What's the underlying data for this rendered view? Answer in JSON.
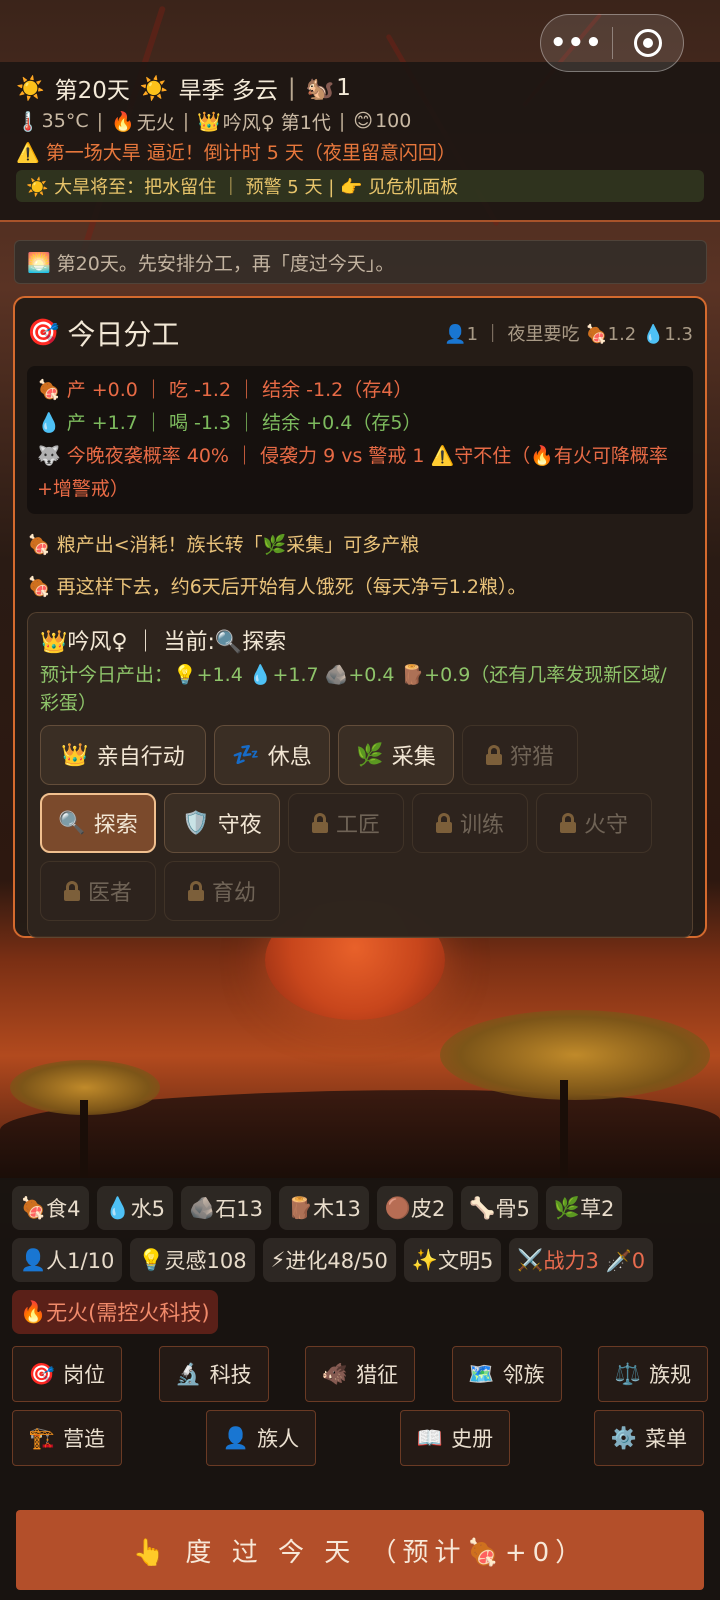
{
  "header": {
    "day_icon": "☀️",
    "day": "第20天",
    "season_icon": "☀️",
    "season": "旱季 多云",
    "sep": "|",
    "pop_icon": "🐿️",
    "pop": "1",
    "temp_icon": "🌡️",
    "temp": "35°C",
    "fire_icon": "🔥",
    "fire": "无火",
    "leader_icon": "👑",
    "leader": "吟风♀ 第1代",
    "mood_icon": "😊",
    "mood": "100",
    "warning": "⚠️ 第一场大旱 逼近！倒计时 5 天（夜里留意闪回）",
    "tip": "☀️ 大旱将至：把水留住 ｜ 预警 5 天 | 👉 见危机面板"
  },
  "capsule": {
    "more": "•••",
    "close_icon": "target-icon"
  },
  "log": {
    "icon": "🌅",
    "text": "第20天。先安排分工，再「度过今天」。"
  },
  "panel": {
    "title_icon": "🎯",
    "title": "今日分工",
    "right": "👤1 ｜ 夜里要吃 🍖1.2 💧1.3",
    "summary_food": "🍖 产 +0.0 ｜ 吃 -1.2 ｜ 结余 -1.2（存4）",
    "summary_water": "💧 产 +1.7 ｜ 喝 -1.3 ｜ 结余 +0.4（存5）",
    "summary_wolf": "🐺 今晚夜袭概率 40% ｜ 侵袭力 9 vs 警戒 1 ⚠️守不住（🔥有火可降概率+增警戒）",
    "note1": "🍖 粮产出<消耗！族长转「🌿采集」可多产粮",
    "note2": "🍖 再这样下去，约6天后开始有人饿死（每天净亏1.2粮）。",
    "member_head": "👑吟风♀ ｜ 当前:🔍探索",
    "member_out": "预计今日产出：💡+1.4 💧+1.7 🪨+0.4 🪵+0.9（还有几率发现新区域/彩蛋）",
    "jobs": [
      {
        "icon": "👑",
        "label": "亲自行动"
      },
      {
        "icon": "💤",
        "label": "休息"
      },
      {
        "icon": "🌿",
        "label": "采集"
      },
      {
        "icon": "",
        "label": "狩猎"
      },
      {
        "icon": "🔍",
        "label": "探索"
      },
      {
        "icon": "🛡️",
        "label": "守夜"
      },
      {
        "icon": "",
        "label": "工匠"
      },
      {
        "icon": "",
        "label": "训练"
      },
      {
        "icon": "",
        "label": "火守"
      },
      {
        "icon": "",
        "label": "医者"
      },
      {
        "icon": "",
        "label": "育幼"
      }
    ]
  },
  "resources": [
    {
      "icon": "🍖",
      "label": "食4"
    },
    {
      "icon": "💧",
      "label": "水5"
    },
    {
      "icon": "🪨",
      "label": "石13"
    },
    {
      "icon": "🪵",
      "label": "木13"
    },
    {
      "icon": "🟤",
      "label": "皮2"
    },
    {
      "icon": "🦴",
      "label": "骨5"
    },
    {
      "icon": "🌿",
      "label": "草2"
    },
    {
      "icon": "👤",
      "label": "人1/10"
    },
    {
      "icon": "💡",
      "label": "灵感108"
    },
    {
      "icon": "⚡",
      "label": "进化48/50"
    },
    {
      "icon": "✨",
      "label": "文明5"
    },
    {
      "icon": "⚔️",
      "label": "战力3 🗡️0"
    },
    {
      "icon": "🔥",
      "label": "无火(需控火科技)"
    }
  ],
  "nav": [
    {
      "icon": "🎯",
      "label": "岗位"
    },
    {
      "icon": "🔬",
      "label": "科技"
    },
    {
      "icon": "🐗",
      "label": "猎征"
    },
    {
      "icon": "🗺️",
      "label": "邻族"
    },
    {
      "icon": "⚖️",
      "label": "族规"
    },
    {
      "icon": "🏗️",
      "label": "营造"
    },
    {
      "icon": "👤",
      "label": "族人"
    },
    {
      "icon": "📖",
      "label": "史册"
    },
    {
      "icon": "⚙️",
      "label": "菜单"
    }
  ],
  "end_day": "👆 度 过 今 天  （预计🍖+0）"
}
